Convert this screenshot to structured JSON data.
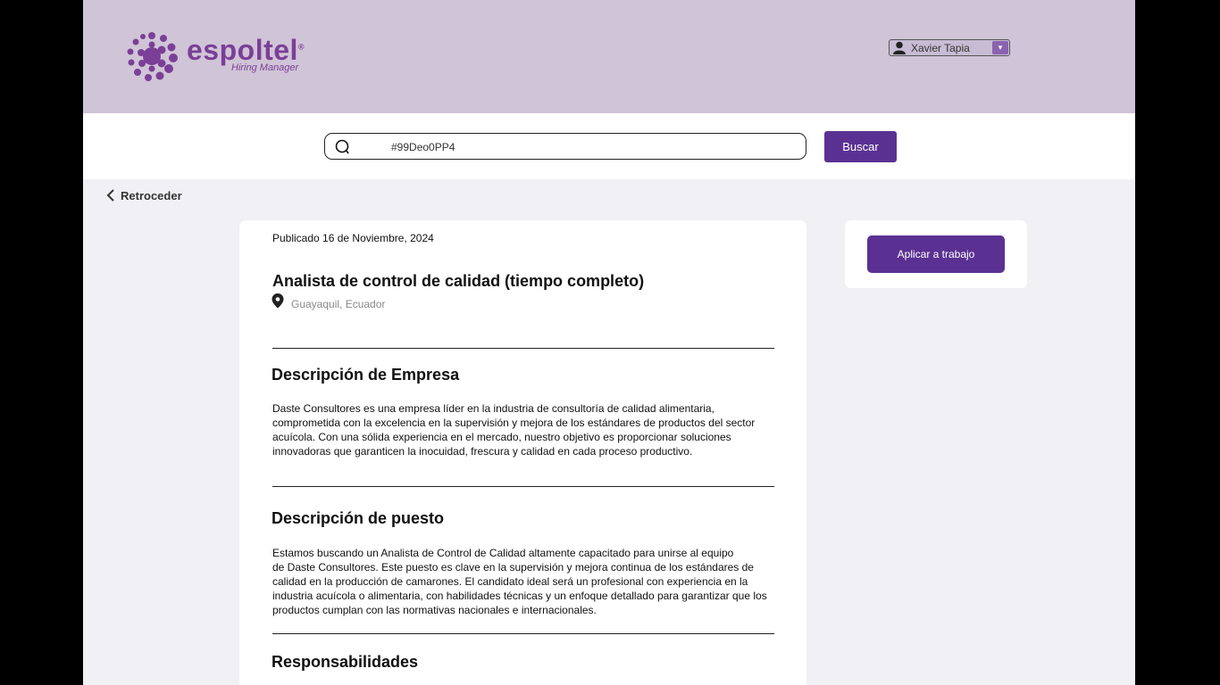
{
  "header": {
    "brand": "espoltel",
    "brand_registered": "®",
    "brand_subtitle": "Hiring Manager",
    "user": {
      "name": "Xavier Tapia",
      "icon": "user-icon",
      "dropdown_icon": "chevron-down-icon"
    }
  },
  "search": {
    "value": "#99Deo0PP4",
    "icon": "search-icon",
    "button_label": "Buscar"
  },
  "nav": {
    "back_label": "Retroceder",
    "back_icon": "chevron-left-icon"
  },
  "job": {
    "published": "Publicado 16 de Noviembre, 2024",
    "title": "Analista de control de calidad (tiempo completo)",
    "location": "Guayaquil, Ecuador",
    "location_icon": "map-pin-icon",
    "sections": [
      {
        "title": "Descripción de Empresa",
        "lines": [
          "Daste Consultores es una empresa líder en la industria de consultoría de calidad alimentaria,",
          "comprometida con la excelencia en la supervisión y mejora de los estándares de productos del sector",
          "acuícola. Con una sólida experiencia en el mercado, nuestro objetivo es proporcionar soluciones",
          "innovadoras que garanticen la inocuidad, frescura y calidad en cada proceso productivo."
        ]
      },
      {
        "title": "Descripción de puesto",
        "lines": [
          "Estamos buscando un Analista de Control de Calidad altamente capacitado para unirse al equipo",
          "de Daste Consultores. Este puesto es clave en la supervisión y mejora continua de los estándares de",
          "calidad en la producción de camarones. El candidato ideal será un profesional con experiencia en la",
          "industria acuícola o alimentaria, con habilidades técnicas y un enfoque detallado para garantizar que los",
          "productos cumplan con las normativas nacionales e internacionales."
        ]
      },
      {
        "title": "Responsabilidades",
        "lines": []
      }
    ]
  },
  "apply": {
    "button_label": "Aplicar a trabajo"
  },
  "colors": {
    "header_bg": "#d0c4d7",
    "accent": "#5a3192",
    "brand": "#7b3f97",
    "page_bg": "#f1f0f5"
  }
}
